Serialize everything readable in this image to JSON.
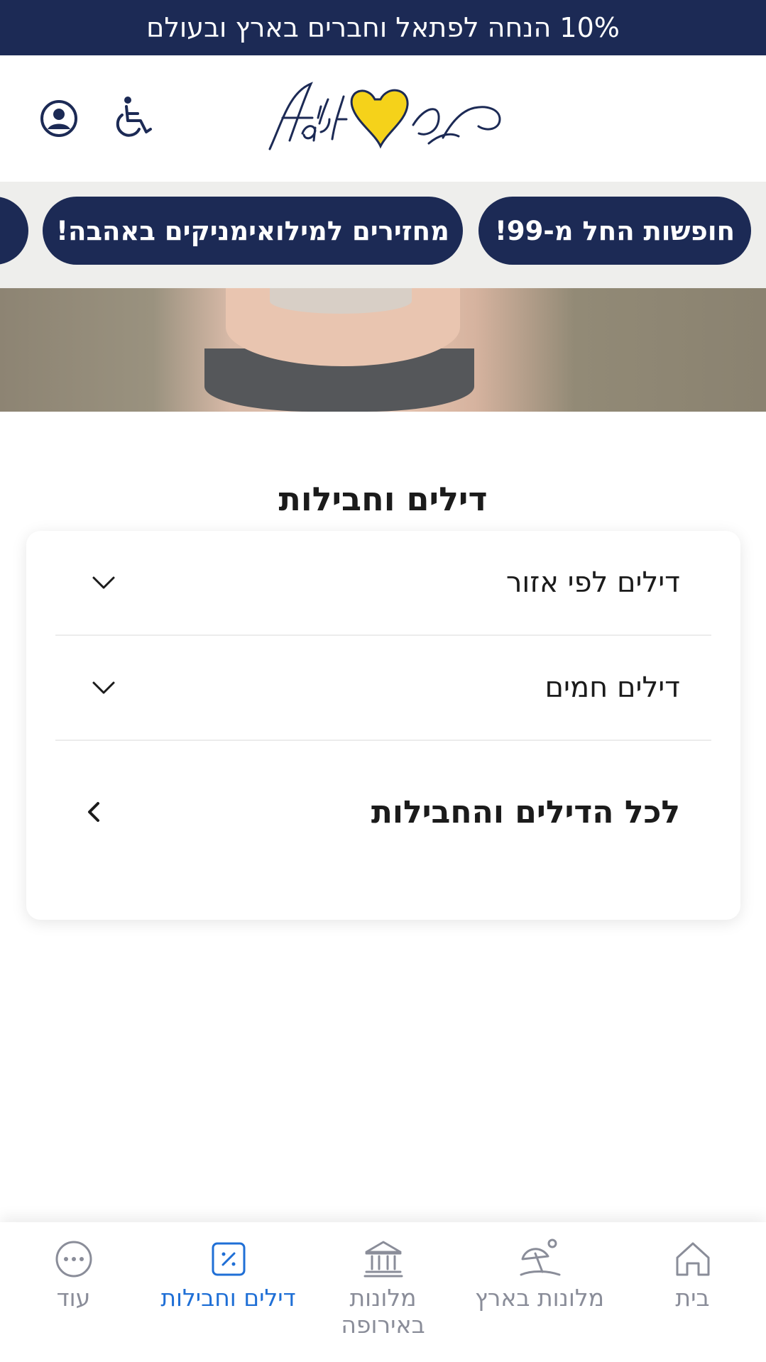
{
  "promo_bar": {
    "text": "10% הנחה לפתאל וחברים בארץ ובעולם"
  },
  "header": {
    "logo_icon": "fattal-heart-logo",
    "accessibility_icon": "wheelchair-icon",
    "account_icon": "user-circle-icon"
  },
  "chips": [
    {
      "label": "חופשות החל מ-99!"
    },
    {
      "label": "מחזירים למילואימניקים באהבה!"
    }
  ],
  "section": {
    "title": "דילים וחבילות",
    "rows": [
      {
        "label": "דילים לפי אזור",
        "icon": "chevron-down-icon"
      },
      {
        "label": "דילים חמים",
        "icon": "chevron-down-icon"
      },
      {
        "label": "לכל הדילים והחבילות",
        "icon": "chevron-left-icon"
      }
    ]
  },
  "bottom_nav": {
    "items": [
      {
        "label": "בית",
        "icon": "home-icon",
        "active": false
      },
      {
        "label": "מלונות בארץ",
        "icon": "beach-umbrella-icon",
        "active": false
      },
      {
        "label": "מלונות באירופה",
        "icon": "building-columns-icon",
        "active": false
      },
      {
        "label": "דילים וחבילות",
        "icon": "percent-tag-icon",
        "active": true
      },
      {
        "label": "עוד",
        "icon": "more-dots-icon",
        "active": false
      }
    ]
  },
  "colors": {
    "brand_navy": "#1c2a55",
    "brand_yellow": "#f5d21a",
    "nav_active": "#1f6fd6",
    "nav_inactive": "#8a8d99"
  }
}
